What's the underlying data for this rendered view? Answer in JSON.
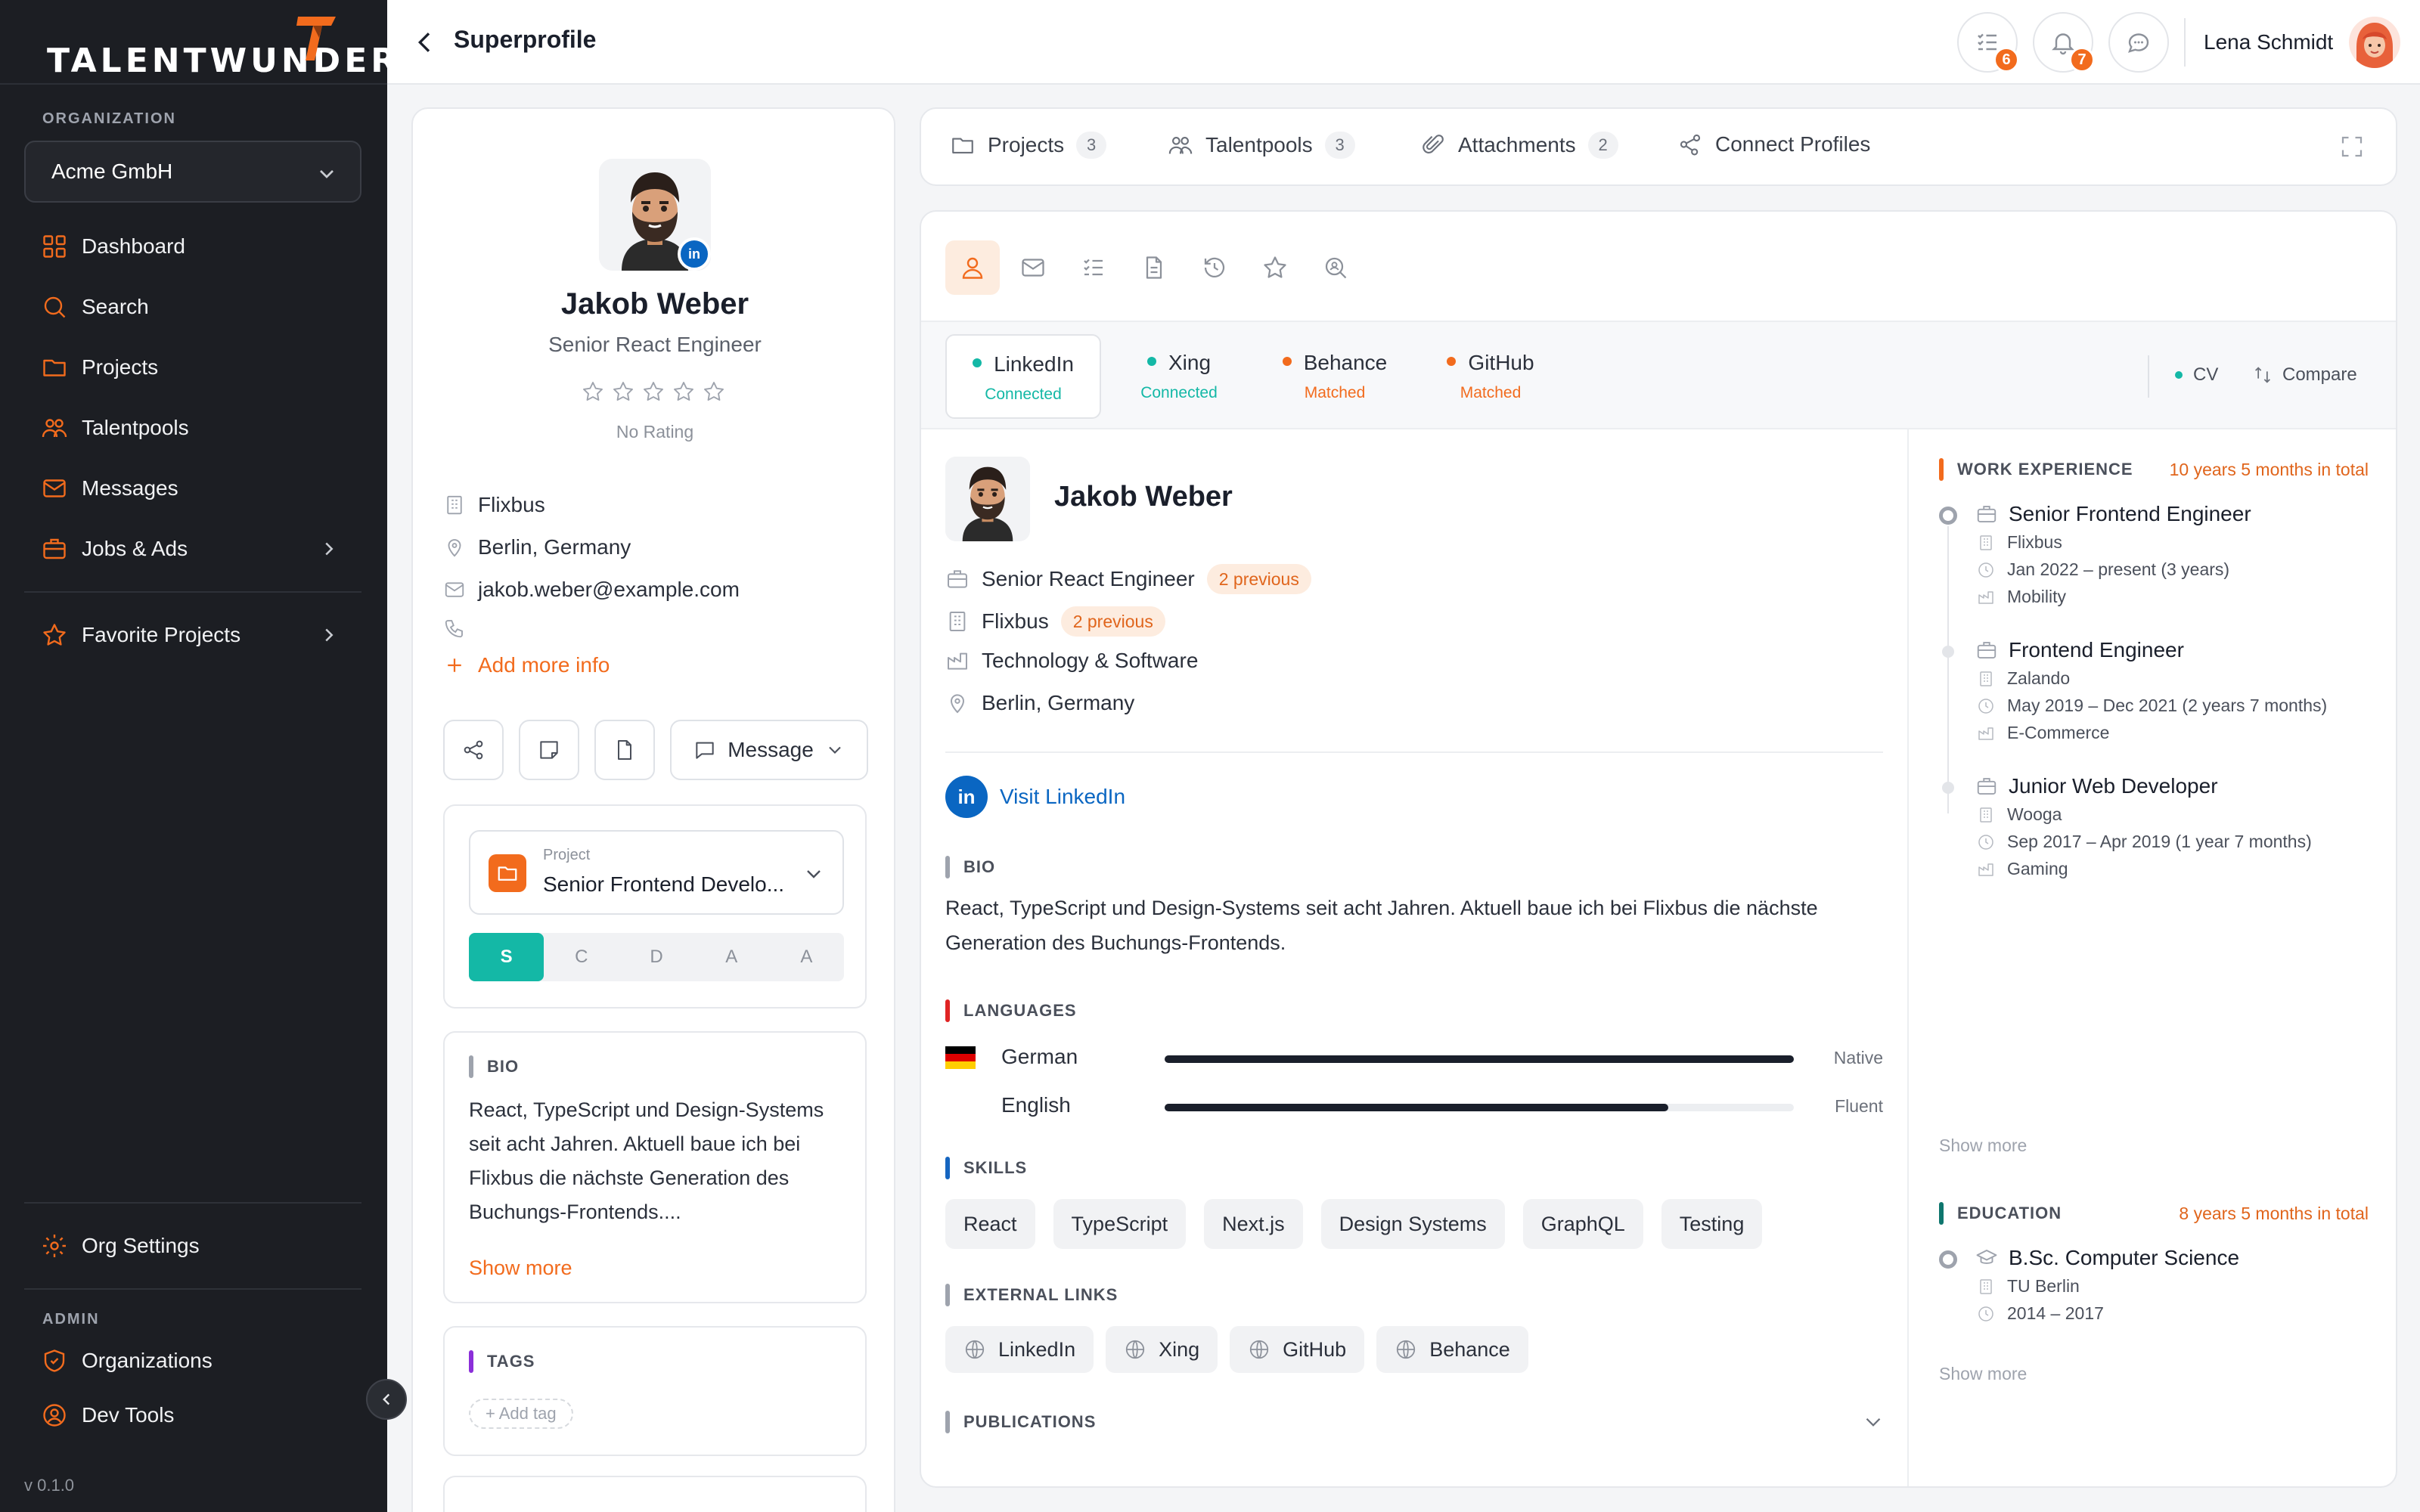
{
  "app": {
    "brand": "TALENTWUNDER",
    "version": "v 0.1.0"
  },
  "sidebar": {
    "org_label": "ORGANIZATION",
    "org_value": "Acme GmbH",
    "items": [
      {
        "label": "Dashboard",
        "icon": "grid-icon"
      },
      {
        "label": "Search",
        "icon": "search-icon"
      },
      {
        "label": "Projects",
        "icon": "folder-icon"
      },
      {
        "label": "Talentpools",
        "icon": "users-icon"
      },
      {
        "label": "Messages",
        "icon": "mail-icon"
      },
      {
        "label": "Jobs & Ads",
        "icon": "briefcase-icon"
      }
    ],
    "favorites": "Favorite Projects",
    "org_settings": "Org Settings",
    "admin_label": "ADMIN",
    "admin_items": [
      {
        "label": "Organizations",
        "icon": "shield-icon"
      },
      {
        "label": "Dev Tools",
        "icon": "user-circle-icon"
      }
    ]
  },
  "topbar": {
    "title": "Superprofile",
    "tasks_count": "6",
    "notifications_count": "7",
    "user_name": "Lena Schmidt"
  },
  "profile": {
    "name": "Jakob Weber",
    "headline": "Senior React Engineer",
    "rating": 0,
    "rating_label": "No Rating",
    "company": "Flixbus",
    "location": "Berlin, Germany",
    "email": "jakob.weber@example.com",
    "phone": "",
    "add_more": "Add more info",
    "message_label": "Message",
    "project_label": "Project",
    "project_value": "Senior Frontend Develo...",
    "stages": [
      "S",
      "C",
      "D",
      "A",
      "A"
    ],
    "bio_title": "BIO",
    "bio_short": "React, TypeScript und Design-Systems seit acht Jahren. Aktuell baue ich bei Flixbus die nächste Generation des Buchungs-Frontends....",
    "show_more": "Show more",
    "tags_title": "TAGS",
    "add_tag": "+ Add tag"
  },
  "tabs": [
    {
      "label": "Projects",
      "count": "3"
    },
    {
      "label": "Talentpools",
      "count": "3"
    },
    {
      "label": "Attachments",
      "count": "2"
    },
    {
      "label": "Connect Profiles",
      "count": ""
    }
  ],
  "sources": [
    {
      "name": "LinkedIn",
      "status": "Connected",
      "color": "#14b8a6"
    },
    {
      "name": "Xing",
      "status": "Connected",
      "color": "#14b8a6"
    },
    {
      "name": "Behance",
      "status": "Matched",
      "color": "#f26b1d"
    },
    {
      "name": "GitHub",
      "status": "Matched",
      "color": "#f26b1d"
    }
  ],
  "strip_actions": {
    "cv": "CV",
    "compare": "Compare"
  },
  "detail": {
    "name": "Jakob Weber",
    "position": "Senior React Engineer",
    "position_prev": "2 previous",
    "company": "Flixbus",
    "company_prev": "2 previous",
    "industry": "Technology & Software",
    "location": "Berlin, Germany",
    "visit": "Visit LinkedIn",
    "bio_title": "BIO",
    "bio": "React, TypeScript und Design-Systems seit acht Jahren. Aktuell baue ich bei Flixbus die nächste Generation des Buchungs-Frontends.",
    "languages_title": "LANGUAGES",
    "languages": [
      {
        "name": "German",
        "level": "Native",
        "proficiency": 1.0
      },
      {
        "name": "English",
        "level": "Fluent",
        "proficiency": 0.8
      }
    ],
    "skills_title": "SKILLS",
    "skills": [
      "React",
      "TypeScript",
      "Next.js",
      "Design Systems",
      "GraphQL",
      "Testing"
    ],
    "links_title": "EXTERNAL LINKS",
    "links": [
      "LinkedIn",
      "Xing",
      "GitHub",
      "Behance"
    ],
    "publications_title": "PUBLICATIONS"
  },
  "work": {
    "title": "WORK EXPERIENCE",
    "total": "10 years 5 months in total",
    "items": [
      {
        "title": "Senior Frontend Engineer",
        "company": "Flixbus",
        "dates": "Jan 2022 – present (3 years)",
        "industry": "Mobility"
      },
      {
        "title": "Frontend Engineer",
        "company": "Zalando",
        "dates": "May 2019 – Dec 2021 (2 years 7 months)",
        "industry": "E-Commerce"
      },
      {
        "title": "Junior Web Developer",
        "company": "Wooga",
        "dates": "Sep 2017 – Apr 2019 (1 year 7 months)",
        "industry": "Gaming"
      }
    ],
    "show_more": "Show more"
  },
  "education": {
    "title": "EDUCATION",
    "total": "8 years 5 months in total",
    "items": [
      {
        "title": "B.Sc. Computer Science",
        "school": "TU Berlin",
        "dates": "2014 – 2017"
      }
    ],
    "show_more": "Show more"
  },
  "colors": {
    "accent": "#f26b1d",
    "teal": "#14b8a6",
    "sidebar": "#1c1e23",
    "linkedin": "#0a66c2"
  }
}
